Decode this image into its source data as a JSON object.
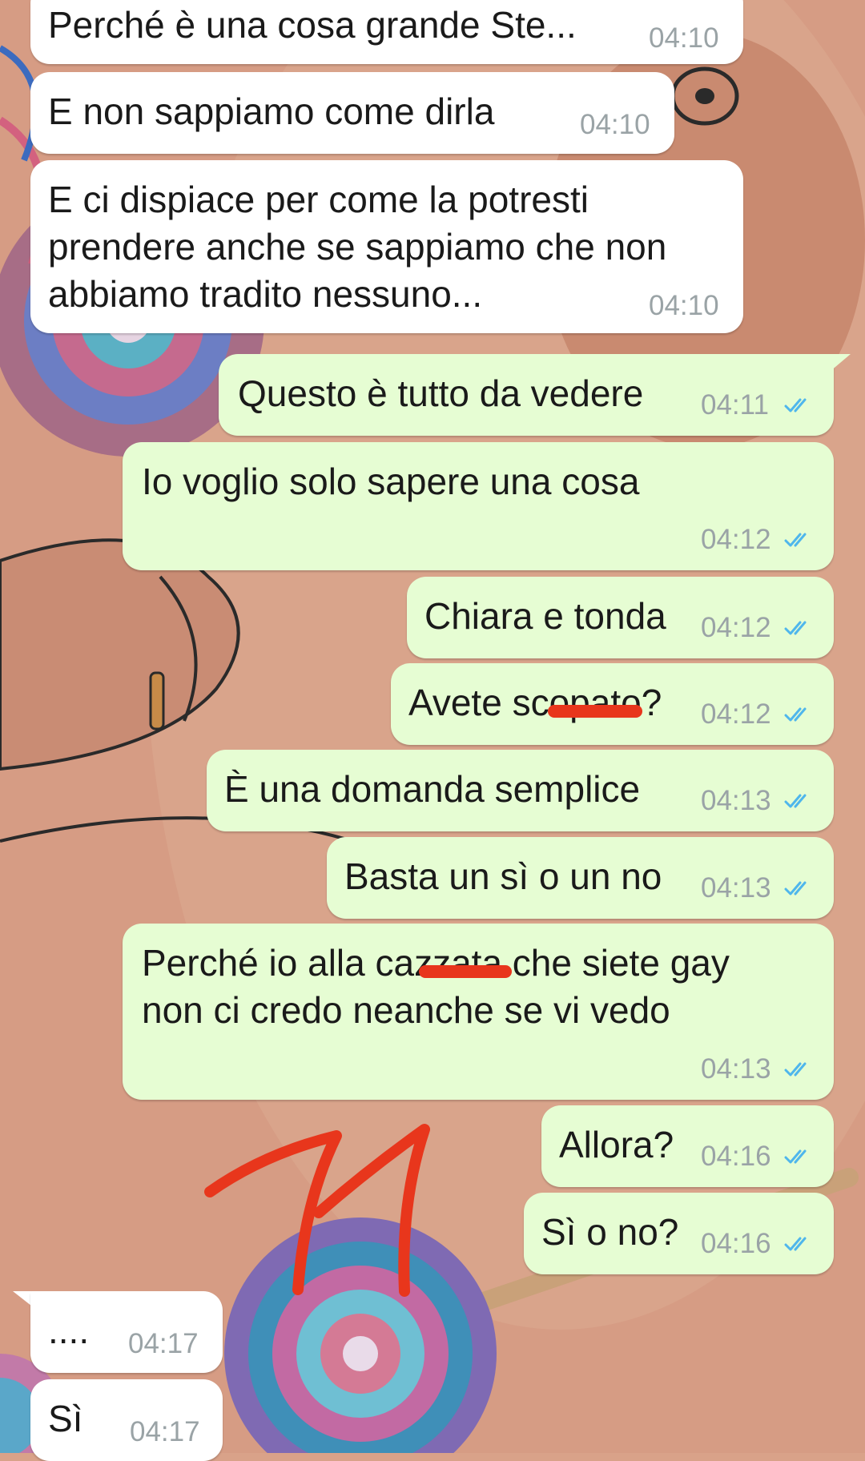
{
  "chat": {
    "messages": [
      {
        "id": "m1",
        "dir": "in",
        "text": "Perché è una cosa grande Ste...",
        "time": "04:10"
      },
      {
        "id": "m2",
        "dir": "in",
        "text": "E non sappiamo come dirla",
        "time": "04:10"
      },
      {
        "id": "m3",
        "dir": "in",
        "text": "E ci dispiace per come la potresti\nprendere anche se sappiamo che non\nabbiamo tradito nessuno...",
        "time": "04:10"
      },
      {
        "id": "m4",
        "dir": "out",
        "text": "Questo è tutto da vedere",
        "time": "04:11",
        "status": "read"
      },
      {
        "id": "m5",
        "dir": "out",
        "text": "Io voglio solo sapere una cosa",
        "time": "04:12",
        "status": "read"
      },
      {
        "id": "m6",
        "dir": "out",
        "text": "Chiara e tonda",
        "time": "04:12",
        "status": "read"
      },
      {
        "id": "m7",
        "dir": "out",
        "text": "Avete scopato?",
        "time": "04:12",
        "status": "read"
      },
      {
        "id": "m8",
        "dir": "out",
        "text": "È una domanda semplice",
        "time": "04:13",
        "status": "read"
      },
      {
        "id": "m9",
        "dir": "out",
        "text": "Basta un sì o un no",
        "time": "04:13",
        "status": "read"
      },
      {
        "id": "m10",
        "dir": "out",
        "text": "Perché io alla cazzata che siete gay\nnon ci credo neanche se vi vedo",
        "time": "04:13",
        "status": "read"
      },
      {
        "id": "m11",
        "dir": "out",
        "text": "Allora?",
        "time": "04:16",
        "status": "read"
      },
      {
        "id": "m12",
        "dir": "out",
        "text": "Sì o no?",
        "time": "04:16",
        "status": "read"
      },
      {
        "id": "m13",
        "dir": "in",
        "text": "....",
        "time": "04:17"
      },
      {
        "id": "m14",
        "dir": "in",
        "text": "Sì",
        "time": "04:17"
      }
    ]
  },
  "colors": {
    "incoming_bubble": "#ffffff",
    "outgoing_bubble": "#e6fdd3",
    "read_ticks": "#4fb6ec",
    "timestamp": "#9aa3a6",
    "annotation_marker": "#e8361c"
  },
  "icons": {
    "read_status": "double-check-icon"
  }
}
